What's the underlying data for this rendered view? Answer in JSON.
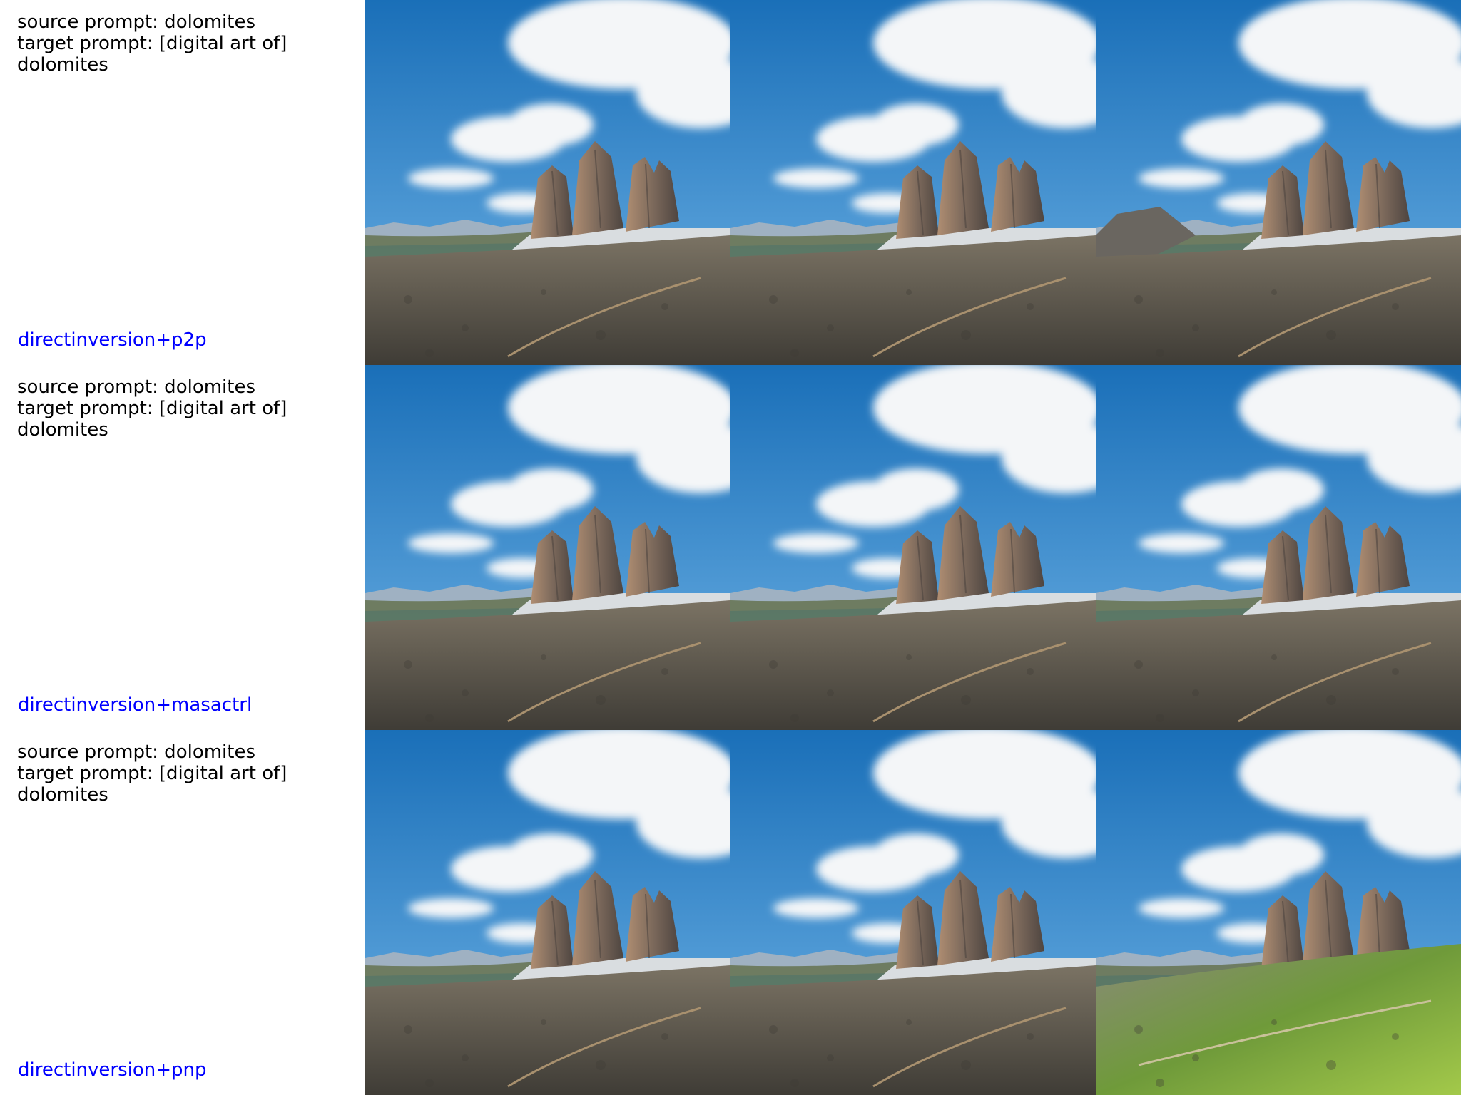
{
  "rows": [
    {
      "prompt_lines": [
        "source prompt: dolomites",
        "target prompt: [digital art of]",
        "dolomites"
      ],
      "method": "directinversion+p2p",
      "images": [
        "source",
        "reconstruction",
        "edited"
      ]
    },
    {
      "prompt_lines": [
        "source prompt: dolomites",
        "target prompt: [digital art of]",
        "dolomites"
      ],
      "method": "directinversion+masactrl",
      "images": [
        "source",
        "reconstruction",
        "edited"
      ]
    },
    {
      "prompt_lines": [
        "source prompt: dolomites",
        "target prompt: [digital art of]",
        "dolomites"
      ],
      "method": "directinversion+pnp",
      "images": [
        "source",
        "reconstruction",
        "edited-green"
      ]
    }
  ],
  "colors": {
    "sky_top": "#1a6fb8",
    "sky_bottom": "#6fb3e6",
    "cloud": "#f4f6f8",
    "rock": "#8a7566",
    "rock_dark": "#4e4540",
    "scree": "#d9dde0",
    "ground": "#7b7364",
    "ground_dark": "#3f3c36",
    "grass": "#6f9a3a",
    "method_text": "#0000ff"
  }
}
